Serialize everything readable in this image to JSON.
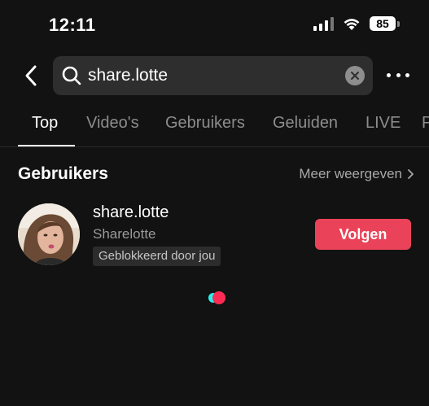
{
  "status_bar": {
    "time": "12:11",
    "battery": "85"
  },
  "search": {
    "query": "share.lotte",
    "placeholder": ""
  },
  "tabs": [
    {
      "label": "Top",
      "active": true
    },
    {
      "label": "Video's",
      "active": false
    },
    {
      "label": "Gebruikers",
      "active": false
    },
    {
      "label": "Geluiden",
      "active": false
    },
    {
      "label": "LIVE",
      "active": false
    },
    {
      "label": "P",
      "active": false
    }
  ],
  "users_section": {
    "title": "Gebruikers",
    "see_more": "Meer weergeven",
    "users": [
      {
        "username": "share.lotte",
        "display_name": "Sharelotte",
        "badge": "Geblokkeerd door jou",
        "follow_label": "Volgen"
      }
    ]
  },
  "colors": {
    "background": "#121212",
    "accent": "#ea4359",
    "loader_cyan": "#25f4ee",
    "loader_red": "#fe2c55"
  }
}
